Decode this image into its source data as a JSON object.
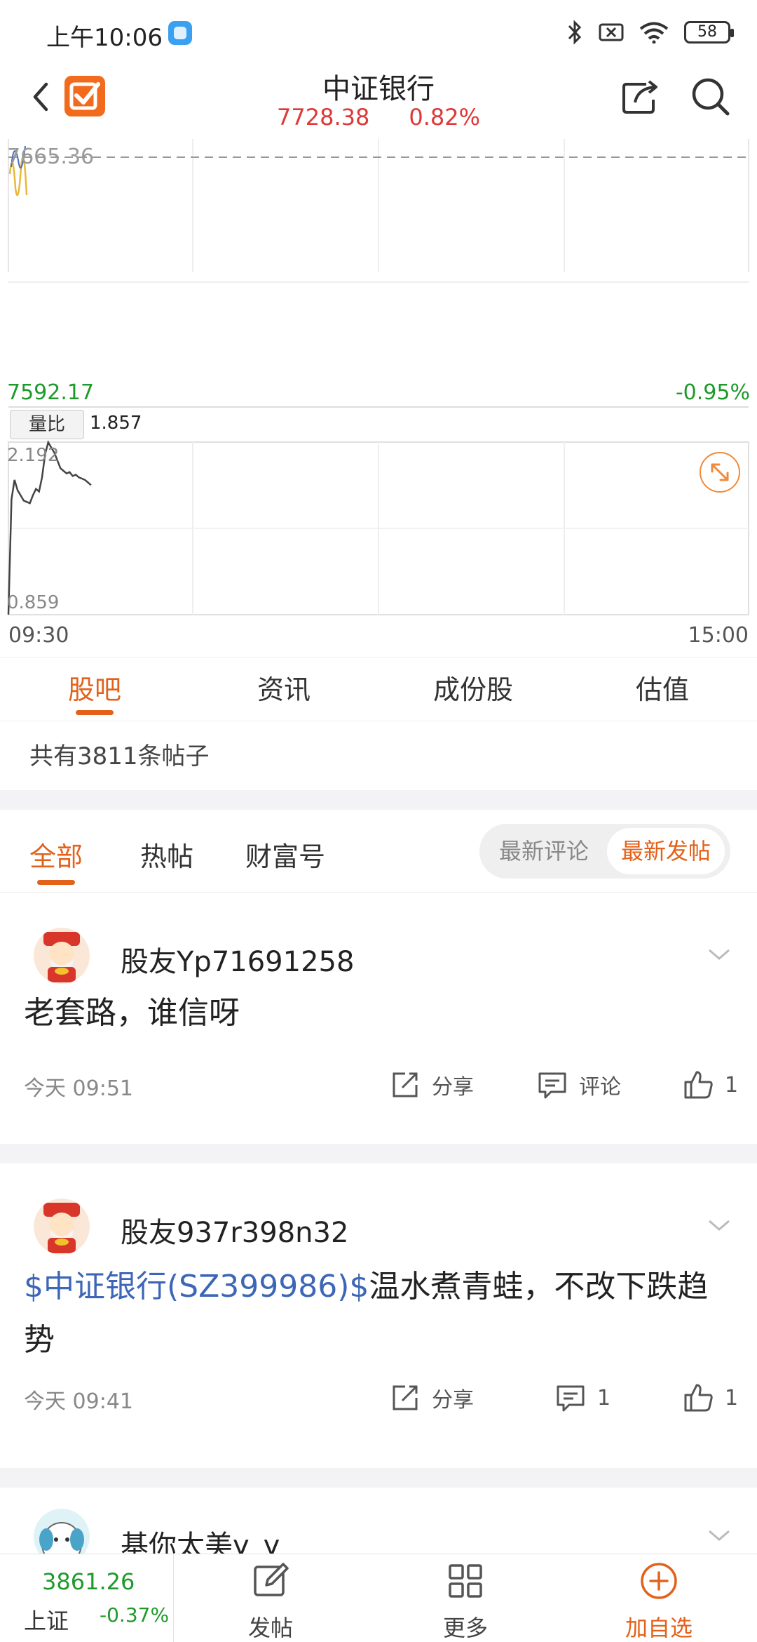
{
  "status_bar": {
    "time": "上午10:06",
    "battery": "58"
  },
  "header": {
    "title": "中证银行",
    "price": "7728.38",
    "change_pct": "0.82%"
  },
  "chart": {
    "price_top": "7665.36",
    "price_low": "7592.17",
    "pct_low": "-0.95%",
    "volume_ratio_label": "量比",
    "volume_ratio_value": "1.857",
    "vr_high": "2.192",
    "vr_low": "0.859",
    "time_start": "09:30",
    "time_end": "15:00"
  },
  "chart_data": {
    "type": "line",
    "title": "",
    "xlabel": "",
    "ylabel": "",
    "x_range": [
      "09:30",
      "15:00"
    ],
    "ylim": [
      0.859,
      2.192
    ],
    "series": [
      {
        "x": [
          "09:30",
          "09:31",
          "09:32",
          "09:33",
          "09:34",
          "09:35",
          "09:36",
          "09:37",
          "09:38",
          "09:39",
          "09:40",
          "09:41",
          "09:42",
          "09:43",
          "09:44",
          "09:45",
          "09:46",
          "09:47",
          "09:48",
          "09:49",
          "09:50",
          "09:51",
          "09:52",
          "09:53",
          "09:54",
          "09:55",
          "09:56",
          "09:57"
        ],
        "values": [
          0.86,
          1.75,
          1.9,
          1.82,
          1.78,
          1.74,
          1.73,
          1.72,
          1.78,
          1.83,
          1.81,
          1.92,
          2.1,
          2.19,
          2.15,
          2.11,
          2.05,
          1.99,
          1.97,
          1.95,
          1.96,
          1.93,
          1.94,
          1.92,
          1.91,
          1.9,
          1.88,
          1.86
        ]
      }
    ]
  },
  "tabs": [
    "股吧",
    "资讯",
    "成份股",
    "估值"
  ],
  "post_count": "共有3811条帖子",
  "sub_tabs": [
    "全部",
    "热帖",
    "财富号"
  ],
  "sort_options": [
    "最新评论",
    "最新发帖"
  ],
  "posts": [
    {
      "user": "股友Yp71691258",
      "text": "老套路，谁信呀",
      "time": "今天 09:51",
      "share": "分享",
      "comments": "评论",
      "likes": "1"
    },
    {
      "user": "股友937r398n32",
      "stock": "$中证银行(SZ399986)$",
      "text": "温水煮青蛙，不改下跌趋势",
      "time": "今天 09:41",
      "share": "分享",
      "comments": "1",
      "likes": "1"
    },
    {
      "user": "基你太美y_y"
    }
  ],
  "bottom_bar": {
    "index_value": "3861.26",
    "index_name": "上证",
    "index_change": "-0.37%",
    "post_label": "发帖",
    "more_label": "更多",
    "add_label": "加自选"
  },
  "colors": {
    "accent": "#e2621b",
    "up": "#e03838",
    "down": "#1e9a2b",
    "link": "#3e66b7"
  }
}
